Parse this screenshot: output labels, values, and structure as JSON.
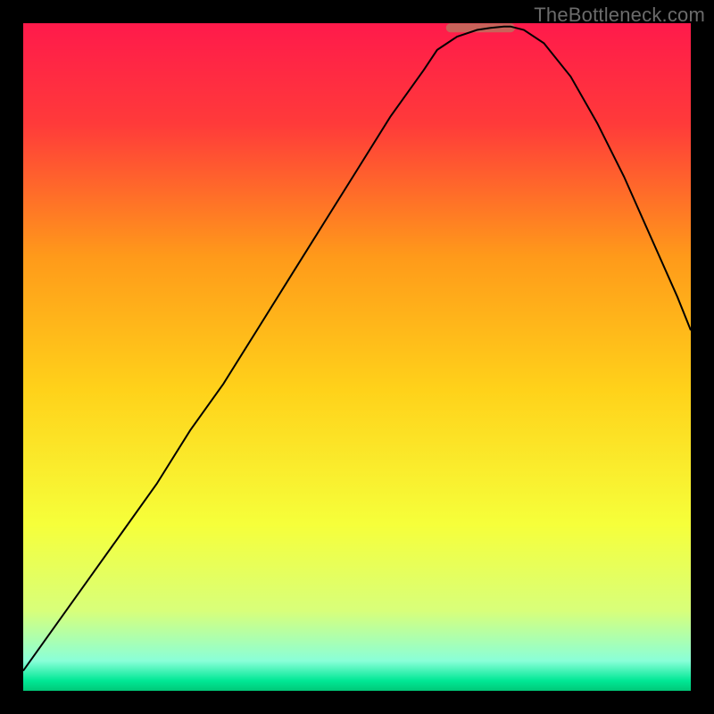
{
  "watermark": "TheBottleneck.com",
  "chart_data": {
    "type": "line",
    "title": "",
    "xlabel": "",
    "ylabel": "",
    "xlim": [
      0,
      100
    ],
    "ylim": [
      0,
      100
    ],
    "background_gradient": [
      {
        "pos": 0.0,
        "color": "#ff1a4b"
      },
      {
        "pos": 0.15,
        "color": "#ff3a3a"
      },
      {
        "pos": 0.35,
        "color": "#ff9a1a"
      },
      {
        "pos": 0.55,
        "color": "#ffd21a"
      },
      {
        "pos": 0.75,
        "color": "#f6ff3a"
      },
      {
        "pos": 0.88,
        "color": "#d8ff7a"
      },
      {
        "pos": 0.955,
        "color": "#8affd8"
      },
      {
        "pos": 0.985,
        "color": "#00e895"
      },
      {
        "pos": 1.0,
        "color": "#00c878"
      }
    ],
    "series": [
      {
        "name": "bottleneck-curve",
        "x": [
          0,
          5,
          10,
          15,
          20,
          25,
          30,
          35,
          40,
          45,
          50,
          55,
          60,
          62,
          65,
          68,
          70,
          72,
          73,
          75,
          78,
          82,
          86,
          90,
          94,
          98,
          100
        ],
        "y": [
          3,
          10,
          17,
          24,
          31,
          39,
          46,
          54,
          62,
          70,
          78,
          86,
          93,
          96,
          98,
          99,
          99.3,
          99.5,
          99.5,
          99,
          97,
          92,
          85,
          77,
          68,
          59,
          54
        ]
      }
    ],
    "flat_segment": {
      "x0": 64,
      "x1": 73,
      "y": 99.3,
      "color": "#c7635a",
      "width": 10
    },
    "curve_style": {
      "color": "#000000",
      "width": 2
    }
  }
}
